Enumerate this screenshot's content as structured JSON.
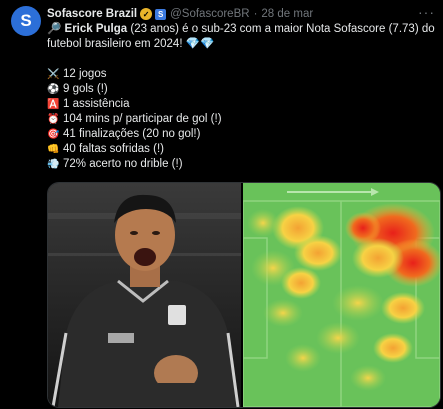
{
  "author": {
    "avatar_letter": "S",
    "name": "Sofascore Brazil",
    "handle": "@SofascoreBR",
    "separator": "·",
    "date": "28 de mar"
  },
  "more_label": "···",
  "tweet": {
    "line1_icon": "🔎",
    "player_name": "Erick Pulga",
    "line1_rest": " (23 anos) é o sub-23 com a maior Nota Sofascore (7.73) do",
    "line2": "futebol brasileiro em 2024! 💎💎",
    "stats": [
      {
        "icon": "⚔️",
        "text": "12 jogos"
      },
      {
        "icon": "⚽",
        "text": "9 gols (!)"
      },
      {
        "icon": "🅰️",
        "text": "1 assistência"
      },
      {
        "icon": "⏰",
        "text": "104 mins p/ participar de gol (!)"
      },
      {
        "icon": "🎯",
        "text": "41 finalizações (20 no gol!)"
      },
      {
        "icon": "👊",
        "text": "40 faltas sofridas (!)"
      },
      {
        "icon": "💨",
        "text": "72% acerto no drible (!)"
      }
    ]
  },
  "colors": {
    "background": "#000000",
    "text": "#e7e9ea",
    "muted": "#71767b",
    "pitch": "#69c25a",
    "heat_hot": "#e8201a",
    "heat_warm": "#f7c23a"
  },
  "media": {
    "photo_icon": "player-celebration-photo",
    "heatmap_icon": "attack-heatmap"
  }
}
